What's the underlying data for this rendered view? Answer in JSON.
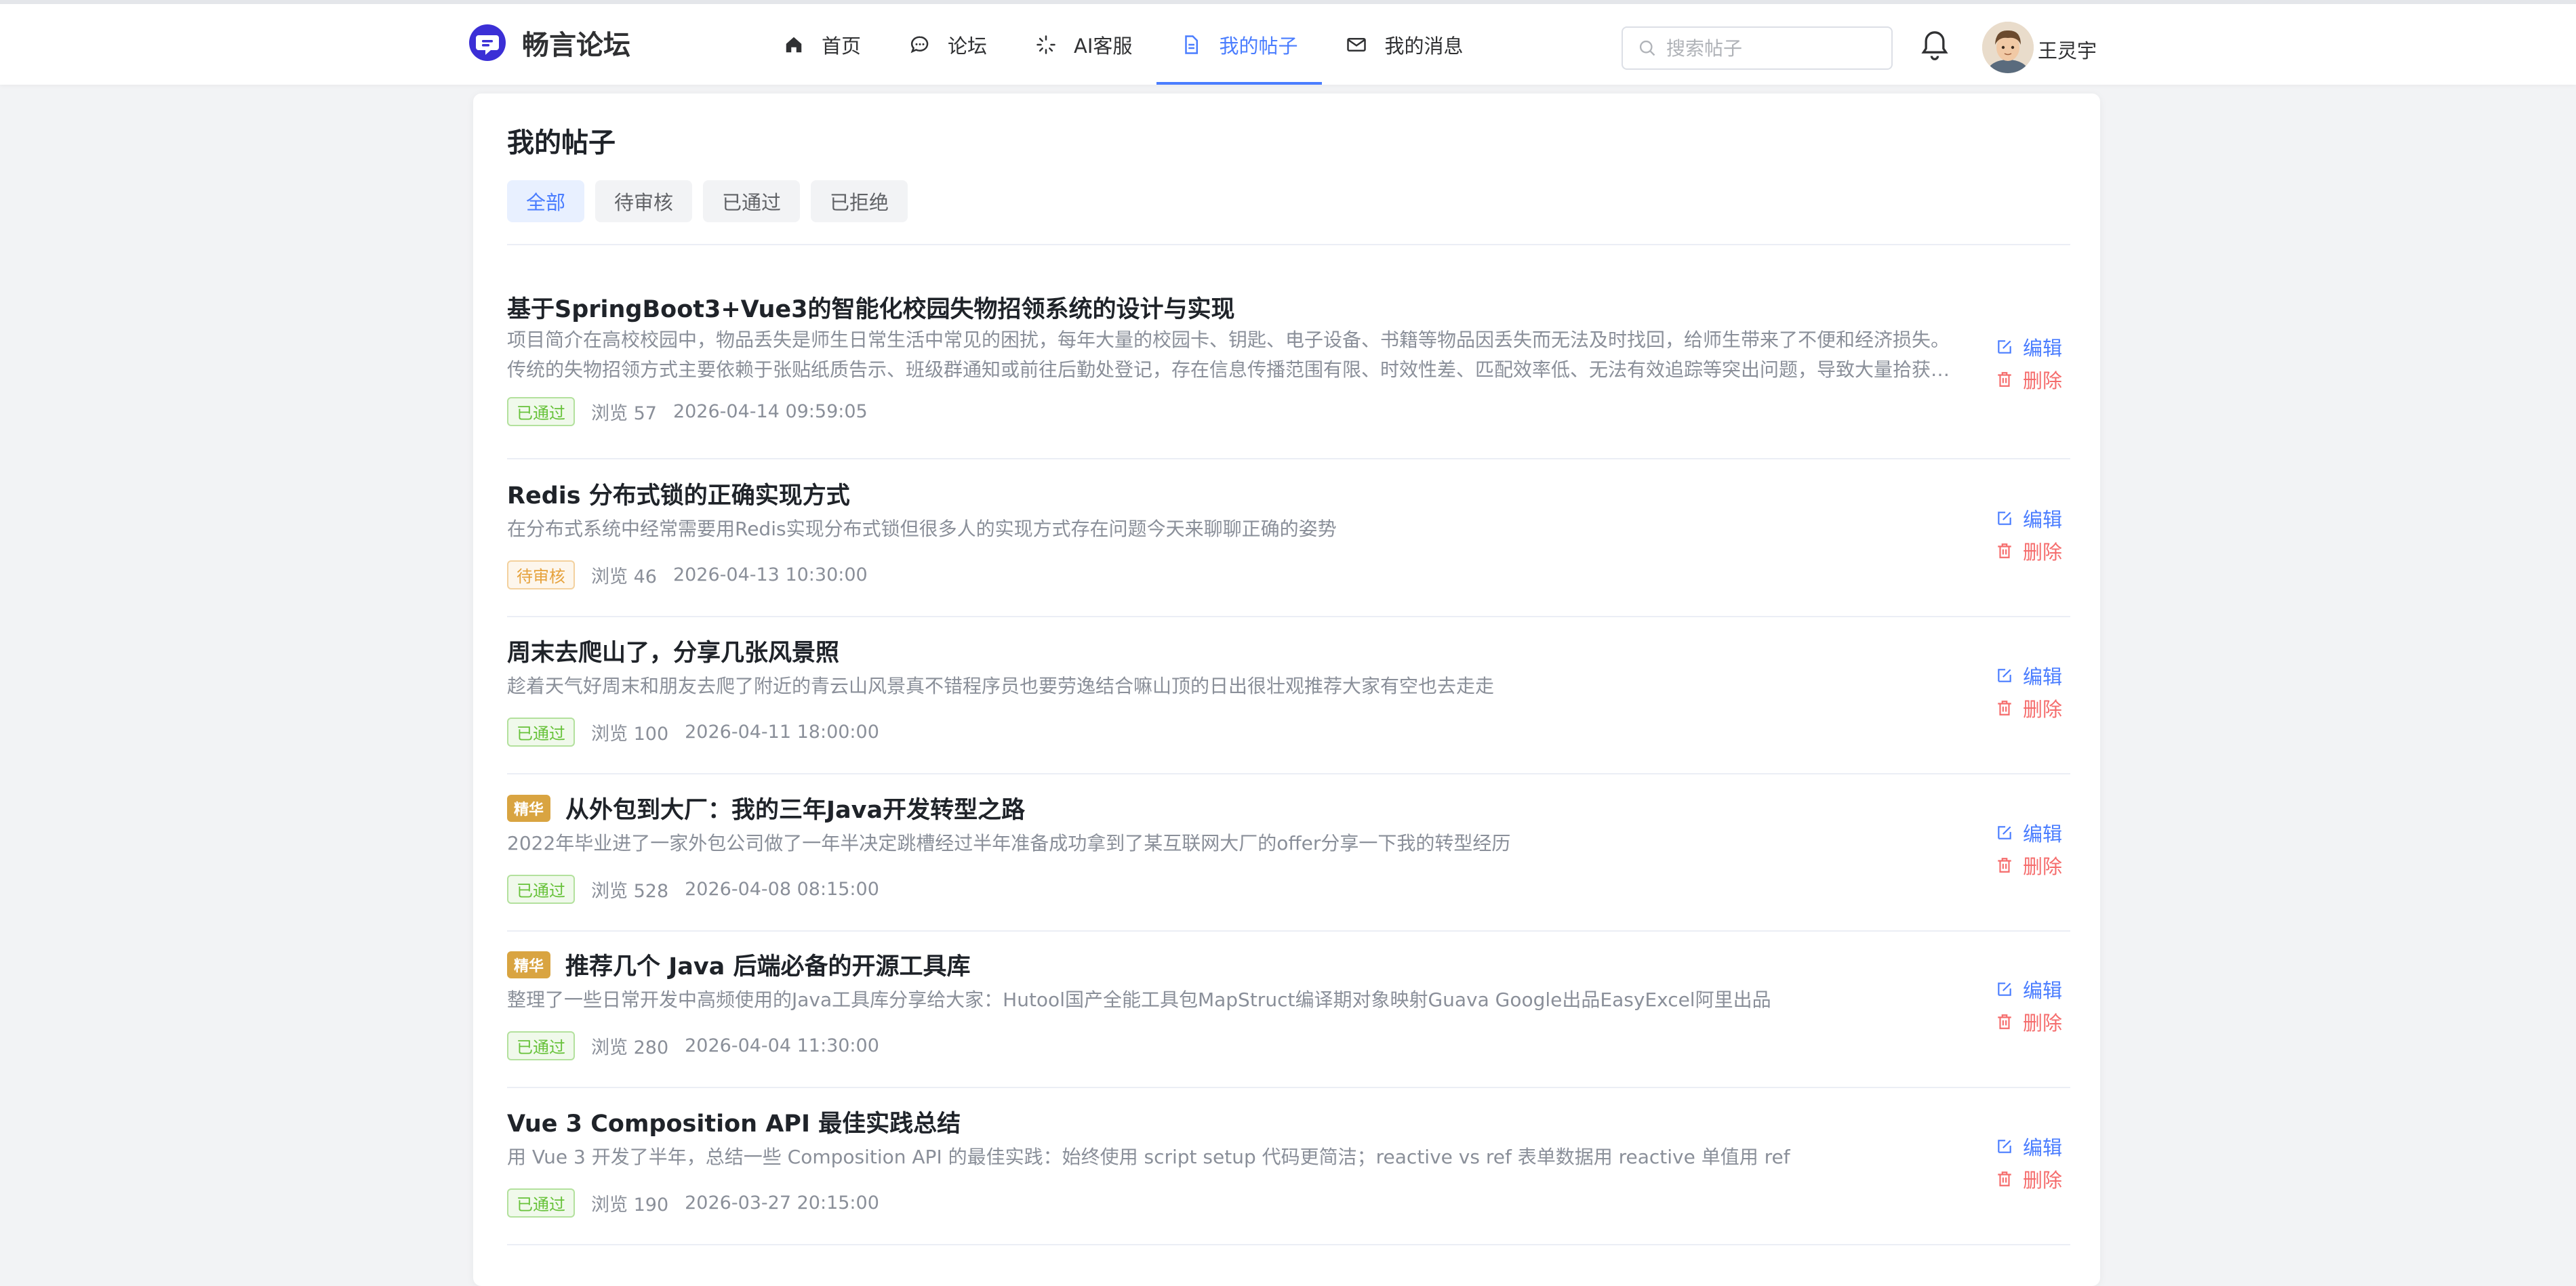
{
  "brand": {
    "name": "畅言论坛"
  },
  "nav": [
    {
      "label": "首页",
      "icon": "home-icon",
      "active": false
    },
    {
      "label": "论坛",
      "icon": "chat-bubble-icon",
      "active": false
    },
    {
      "label": "AI客服",
      "icon": "loading-spinner-icon",
      "active": false
    },
    {
      "label": "我的帖子",
      "icon": "document-icon",
      "active": true
    },
    {
      "label": "我的消息",
      "icon": "mail-icon",
      "active": false
    }
  ],
  "search": {
    "placeholder": "搜索帖子",
    "value": ""
  },
  "user": {
    "name": "王灵宇"
  },
  "page": {
    "title": "我的帖子"
  },
  "tabs": [
    {
      "label": "全部",
      "active": true
    },
    {
      "label": "待审核",
      "active": false
    },
    {
      "label": "已通过",
      "active": false
    },
    {
      "label": "已拒绝",
      "active": false
    }
  ],
  "actions": {
    "edit": "编辑",
    "delete": "删除"
  },
  "posts": [
    {
      "title": "基于SpringBoot3+Vue3的智能化校园失物招领系统的设计与实现",
      "featured": false,
      "summary": "项目简介在高校校园中，物品丢失是师生日常生活中常见的困扰，每年大量的校园卡、钥匙、电子设备、书籍等物品因丢失而无法及时找回，给师生带来了不便和经济损失。传统的失物招领方式主要依赖于张贴纸质告示、班级群通知或前往后勤处登记，存在信息传播范围有限、时效性差、匹配效率低、无法有效追踪等突出问题，导致大量拾获…",
      "status": "已通过",
      "status_type": "ok",
      "views": "浏览 57",
      "time": "2026-04-14 09:59:05"
    },
    {
      "title": "Redis 分布式锁的正确实现方式",
      "featured": false,
      "summary": "在分布式系统中经常需要用Redis实现分布式锁但很多人的实现方式存在问题今天来聊聊正确的姿势",
      "status": "待审核",
      "status_type": "wait",
      "views": "浏览 46",
      "time": "2026-04-13 10:30:00"
    },
    {
      "title": "周末去爬山了，分享几张风景照",
      "featured": false,
      "summary": "趁着天气好周末和朋友去爬了附近的青云山风景真不错程序员也要劳逸结合嘛山顶的日出很壮观推荐大家有空也去走走",
      "status": "已通过",
      "status_type": "ok",
      "views": "浏览 100",
      "time": "2026-04-11 18:00:00"
    },
    {
      "title": "从外包到大厂：我的三年Java开发转型之路",
      "featured": true,
      "featured_label": "精华",
      "summary": "2022年毕业进了一家外包公司做了一年半决定跳槽经过半年准备成功拿到了某互联网大厂的offer分享一下我的转型经历",
      "status": "已通过",
      "status_type": "ok",
      "views": "浏览 528",
      "time": "2026-04-08 08:15:00"
    },
    {
      "title": "推荐几个 Java 后端必备的开源工具库",
      "featured": true,
      "featured_label": "精华",
      "summary": "整理了一些日常开发中高频使用的Java工具库分享给大家：Hutool国产全能工具包MapStruct编译期对象映射Guava Google出品EasyExcel阿里出品",
      "status": "已通过",
      "status_type": "ok",
      "views": "浏览 280",
      "time": "2026-04-04 11:30:00"
    },
    {
      "title": "Vue 3 Composition API 最佳实践总结",
      "featured": false,
      "summary": "用 Vue 3 开发了半年，总结一些 Composition API 的最佳实践：始终使用 script setup 代码更简洁；reactive vs ref 表单数据用 reactive 单值用 ref",
      "status": "已通过",
      "status_type": "ok",
      "views": "浏览 190",
      "time": "2026-03-27 20:15:00"
    }
  ]
}
